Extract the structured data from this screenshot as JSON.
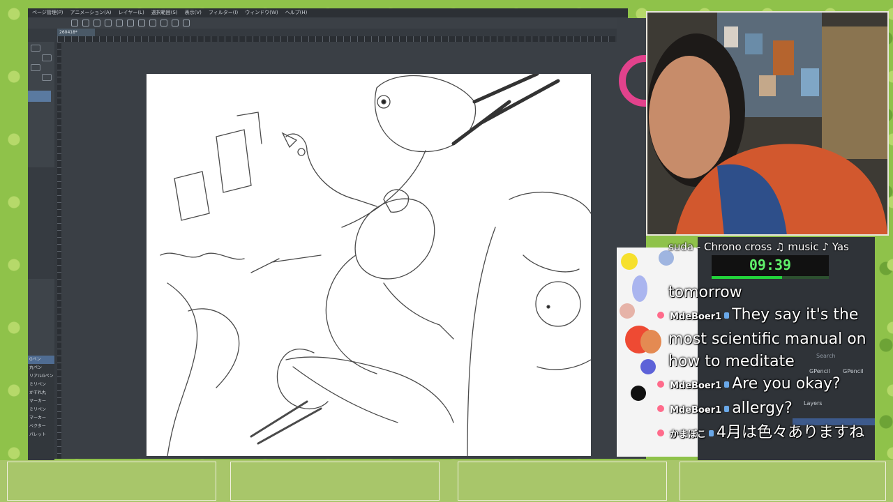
{
  "app": {
    "menu": [
      "ページ管理(P)",
      "アニメーション(A)",
      "レイヤー(L)",
      "選択範囲(S)",
      "表示(V)",
      "フィルター(I)",
      "ウィンドウ(W)",
      "ヘルプ(H)"
    ],
    "document_tab": "260418*",
    "brush_list": [
      "Gペン",
      "丸ペン",
      "リアルGペン",
      "ミリペン",
      "かすれ丸",
      "マーカー",
      "ミリペン",
      "マーカー",
      "ベクター",
      "パレット"
    ],
    "selected_brush": 0
  },
  "layer_panel": {
    "search_placeholder": "Search",
    "tool_label": "GPencil",
    "tool_label_2": "GPencil",
    "layers_label": "Layers"
  },
  "stream": {
    "now_playing": "suda - Chrono cross    ♫ music ♪ Yas",
    "timer": "09:39",
    "timer_progress": 0.6,
    "chat": [
      {
        "user": "",
        "badge": false,
        "text": "tomorrow"
      },
      {
        "user": "MdeBoer1",
        "badge": true,
        "text": "They say it's the most scientific manual on how to meditate"
      },
      {
        "user": "MdeBoer1",
        "badge": true,
        "text": "Are you okay?"
      },
      {
        "user": "MdeBoer1",
        "badge": true,
        "text": "allergy?"
      },
      {
        "user": "かまぼこ",
        "badge": true,
        "text": "4月は色々ありますね"
      }
    ]
  },
  "colors": {
    "accent_green": "#22d33b",
    "timer_text": "#5ff06a",
    "background": "#8fc24a"
  }
}
